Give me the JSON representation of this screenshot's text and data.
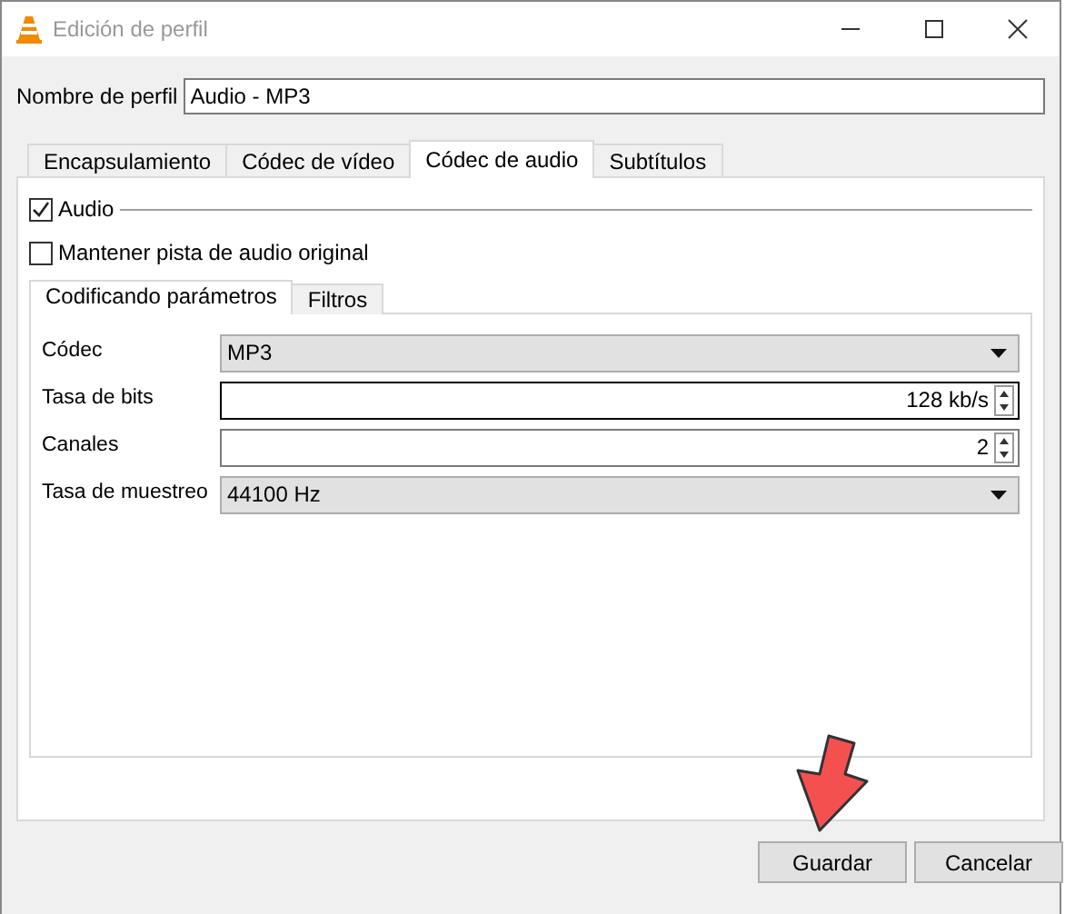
{
  "window": {
    "title": "Edición de perfil"
  },
  "profile_name": {
    "label": "Nombre de perfil",
    "value": "Audio - MP3"
  },
  "tabs": [
    {
      "label": "Encapsulamiento",
      "selected": false
    },
    {
      "label": "Códec de vídeo",
      "selected": false
    },
    {
      "label": "Códec de audio",
      "selected": true
    },
    {
      "label": "Subtítulos",
      "selected": false
    }
  ],
  "audio_checkbox": {
    "label": "Audio",
    "checked": true
  },
  "keep_track_checkbox": {
    "label": "Mantener pista de audio original",
    "checked": false
  },
  "inner_tabs": [
    {
      "label": "Codificando parámetros",
      "selected": true
    },
    {
      "label": "Filtros",
      "selected": false
    }
  ],
  "fields": [
    {
      "kind": "combo",
      "label": "Códec",
      "value": "MP3"
    },
    {
      "kind": "spin",
      "label": "Tasa de bits",
      "value": "128 kb/s",
      "focused": true
    },
    {
      "kind": "spin",
      "label": "Canales",
      "value": "2",
      "focused": false
    },
    {
      "kind": "combo",
      "label": "Tasa de muestreo",
      "value": "44100 Hz"
    }
  ],
  "buttons": [
    "Guardar",
    "Cancelar"
  ]
}
